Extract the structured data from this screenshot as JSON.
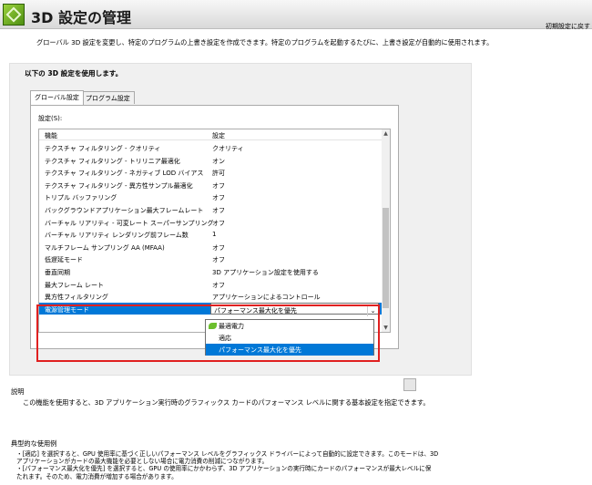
{
  "header": {
    "title": "3D 設定の管理",
    "restore_defaults": "初期設定に戻す"
  },
  "intro": "グローバル 3D 設定を変更し、特定のプログラムの上書き設定を作成できます。特定のプログラムを起動するたびに、上書き設定が自動的に使用されます。",
  "panel": {
    "heading": "以下の 3D 設定を使用します。",
    "tabs": [
      {
        "label": "グローバル設定"
      },
      {
        "label": "プログラム設定"
      }
    ],
    "settings_label": "設定(S):",
    "columns": {
      "feature": "機能",
      "setting": "設定"
    },
    "rows": [
      {
        "feature": "テクスチャ フィルタリング - クオリティ",
        "value": "クオリティ"
      },
      {
        "feature": "テクスチャ フィルタリング - トリリニア最適化",
        "value": "オン"
      },
      {
        "feature": "テクスチャ フィルタリング - ネガティブ LOD バイアス",
        "value": "許可"
      },
      {
        "feature": "テクスチャ フィルタリング - 異方性サンプル最適化",
        "value": "オフ"
      },
      {
        "feature": "トリプル バッファリング",
        "value": "オフ"
      },
      {
        "feature": "バックグラウンドアプリケーション最大フレームレート",
        "value": "オフ"
      },
      {
        "feature": "バーチャル リアリティ - 可変レート スーパーサンプリング",
        "value": "オフ"
      },
      {
        "feature": "バーチャル リアリティ レンダリング前フレーム数",
        "value": "1"
      },
      {
        "feature": "マルチフレーム サンプリング AA (MFAA)",
        "value": "オフ"
      },
      {
        "feature": "低遅延モード",
        "value": "オフ"
      },
      {
        "feature": "垂直同期",
        "value": "3D アプリケーション設定を使用する"
      },
      {
        "feature": "最大フレーム レート",
        "value": "オフ"
      },
      {
        "feature": "異方性フィルタリング",
        "value": "アプリケーションによるコントロール"
      }
    ],
    "selected_row": {
      "feature": "電源管理モード",
      "value": "パフォーマンス最大化を優先"
    },
    "dropdown_options": [
      {
        "label": "最適電力",
        "icon": "leaf-icon"
      },
      {
        "label": "適応"
      },
      {
        "label": "パフォーマンス最大化を優先",
        "highlighted": true
      }
    ]
  },
  "description": {
    "label": "説明",
    "text": "この機能を使用すると、3D アプリケーション実行時のグラフィックス カードのパフォーマンス レベルに関する基本設定を指定できます。"
  },
  "typical_usage": {
    "label": "典型的な使用例",
    "lines": [
      "・[適応] を選択すると、GPU 使用率に基づく正しいパフォーマンス レベルをグラフィックス ドライバーによって自動的に設定できます。このモードは、3D",
      "  アプリケーションがカードの最大機能を必要としない場合に電力消費の削減につながります。",
      "・[パフォーマンス最大化を優先] を選択すると、GPU の使用率にかかわらず、3D アプリケーションの実行時にカードのパフォーマンスが最大レベルに保",
      "  たれます。そのため、電力消費が増加する場合があります。"
    ]
  },
  "colors": {
    "selection": "#0078d7",
    "annotation": "#e02020",
    "accent": "#76b900"
  }
}
